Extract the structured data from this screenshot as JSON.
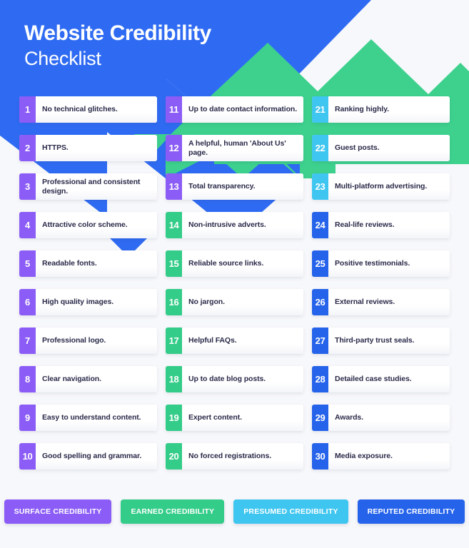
{
  "header": {
    "title_line1": "Website Credibility",
    "title_line2": "Checklist"
  },
  "colors": {
    "page_background": "#f7f8fb",
    "blue": "#2563eb",
    "bright_blue": "#2f6bf2",
    "green": "#33cc88",
    "green_light": "#3dd18d",
    "purple": "#8b5cf6",
    "cyan": "#3fc6f0",
    "card_white": "#ffffff",
    "text_dark": "#2a2a4a"
  },
  "columns": [
    {
      "name": "column-left",
      "items": [
        {
          "number": "1",
          "label": "No technical glitches.",
          "color": "#8b5cf6"
        },
        {
          "number": "2",
          "label": "HTTPS.",
          "color": "#8b5cf6"
        },
        {
          "number": "3",
          "label": "Professional and consistent design.",
          "color": "#8b5cf6"
        },
        {
          "number": "4",
          "label": "Attractive color scheme.",
          "color": "#8b5cf6"
        },
        {
          "number": "5",
          "label": "Readable fonts.",
          "color": "#8b5cf6"
        },
        {
          "number": "6",
          "label": "High quality images.",
          "color": "#8b5cf6"
        },
        {
          "number": "7",
          "label": "Professional logo.",
          "color": "#8b5cf6"
        },
        {
          "number": "8",
          "label": "Clear navigation.",
          "color": "#8b5cf6"
        },
        {
          "number": "9",
          "label": "Easy to understand content.",
          "color": "#8b5cf6"
        },
        {
          "number": "10",
          "label": "Good spelling and grammar.",
          "color": "#8b5cf6"
        }
      ]
    },
    {
      "name": "column-middle",
      "items": [
        {
          "number": "11",
          "label": "Up to date contact information.",
          "color": "#8b5cf6"
        },
        {
          "number": "12",
          "label": "A helpful, human 'About Us' page.",
          "color": "#8b5cf6"
        },
        {
          "number": "13",
          "label": "Total transparency.",
          "color": "#8b5cf6"
        },
        {
          "number": "14",
          "label": "Non-intrusive adverts.",
          "color": "#33cc88"
        },
        {
          "number": "15",
          "label": "Reliable source links.",
          "color": "#33cc88"
        },
        {
          "number": "16",
          "label": "No jargon.",
          "color": "#33cc88"
        },
        {
          "number": "17",
          "label": "Helpful FAQs.",
          "color": "#33cc88"
        },
        {
          "number": "18",
          "label": "Up to date blog posts.",
          "color": "#33cc88"
        },
        {
          "number": "19",
          "label": "Expert content.",
          "color": "#33cc88"
        },
        {
          "number": "20",
          "label": "No forced registrations.",
          "color": "#33cc88"
        }
      ]
    },
    {
      "name": "column-right",
      "items": [
        {
          "number": "21",
          "label": "Ranking highly.",
          "color": "#3fc6f0"
        },
        {
          "number": "22",
          "label": "Guest posts.",
          "color": "#3fc6f0"
        },
        {
          "number": "23",
          "label": "Multi-platform advertising.",
          "color": "#3fc6f0"
        },
        {
          "number": "24",
          "label": "Real-life reviews.",
          "color": "#2563eb"
        },
        {
          "number": "25",
          "label": "Positive testimonials.",
          "color": "#2563eb"
        },
        {
          "number": "26",
          "label": "External reviews.",
          "color": "#2563eb"
        },
        {
          "number": "27",
          "label": "Third-party trust seals.",
          "color": "#2563eb"
        },
        {
          "number": "28",
          "label": "Detailed case studies.",
          "color": "#2563eb"
        },
        {
          "number": "29",
          "label": "Awards.",
          "color": "#2563eb"
        },
        {
          "number": "30",
          "label": "Media exposure.",
          "color": "#2563eb"
        }
      ]
    }
  ],
  "legend": [
    {
      "label": "SURFACE CREDIBILITY",
      "color": "#8b5cf6"
    },
    {
      "label": "EARNED CREDIBILITY",
      "color": "#33cc88"
    },
    {
      "label": "PRESUMED CREDIBILITY",
      "color": "#3fc6f0"
    },
    {
      "label": "REPUTED CREDIBILITY",
      "color": "#2563eb"
    }
  ]
}
